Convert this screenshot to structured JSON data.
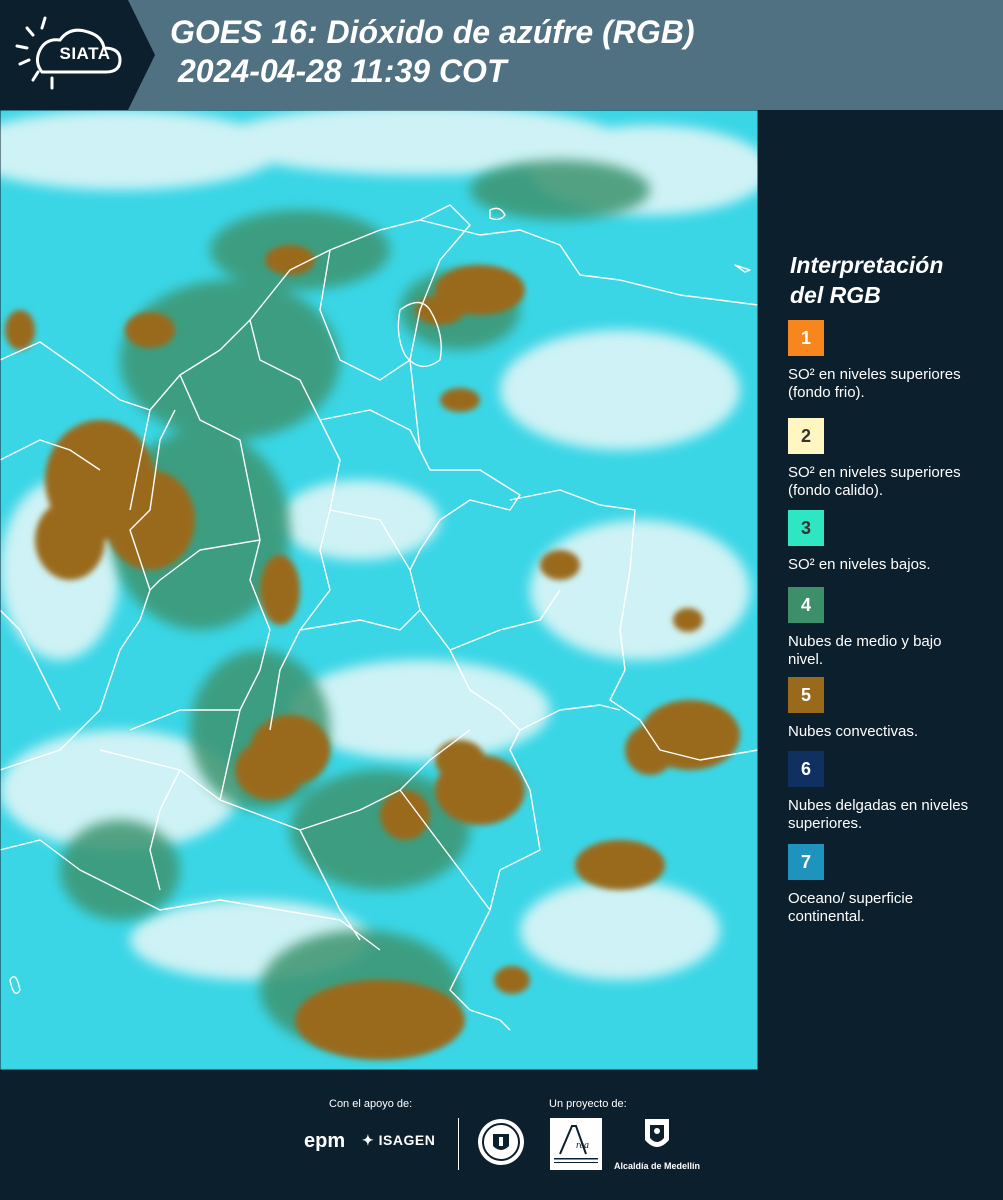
{
  "header": {
    "logo_text": "SIATA",
    "title_line1": "GOES 16: Dióxido de azúfre (RGB)",
    "title_line2": "2024-04-28 11:39 COT"
  },
  "legend": {
    "title_line1": "Interpretación",
    "title_line2": "del RGB",
    "items": [
      {
        "number": "1",
        "color": "#f7861f",
        "text_color": "#ffffff",
        "text": "SO² en niveles superiores (fondo frio)."
      },
      {
        "number": "2",
        "color": "#fff6c2",
        "text_color": "#333333",
        "text": "SO² en niveles superiores (fondo calido)."
      },
      {
        "number": "3",
        "color": "#2ee6c2",
        "text_color": "#333333",
        "text": "SO² en niveles bajos."
      },
      {
        "number": "4",
        "color": "#3d8f6a",
        "text_color": "#ffffff",
        "text": "Nubes de medio y bajo nivel."
      },
      {
        "number": "5",
        "color": "#9a6a1c",
        "text_color": "#ffffff",
        "text": "Nubes convectivas."
      },
      {
        "number": "6",
        "color": "#0f3060",
        "text_color": "#ffffff",
        "text": "Nubes delgadas en niveles superiores."
      },
      {
        "number": "7",
        "color": "#1e93be",
        "text_color": "#ffffff",
        "text": "Oceano/ superficie continental."
      }
    ]
  },
  "footer": {
    "support_label": "Con el apoyo de:",
    "project_label": "Un proyecto de:",
    "epm_logo": "epm",
    "isagen_logo": "ISAGEN",
    "area_logo": "Área Metropolitana Valle de Aburrá",
    "alcaldia_label": "Alcaldía de Medellín"
  }
}
